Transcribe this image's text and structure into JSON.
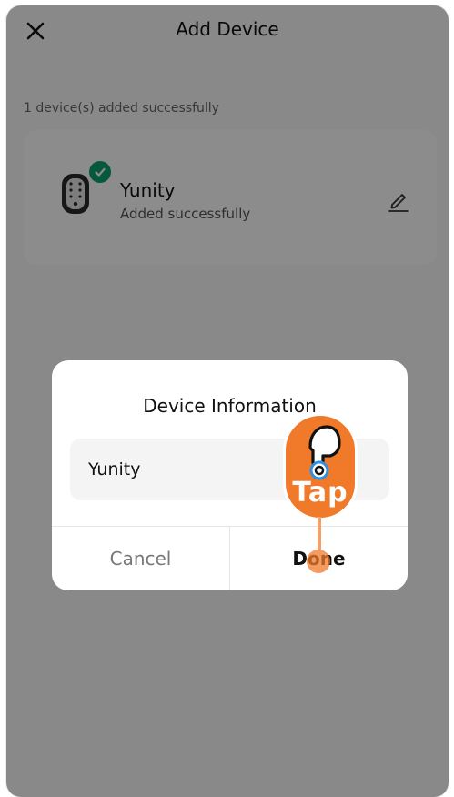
{
  "header": {
    "title": "Add Device"
  },
  "status": {
    "success_count_text": "1 device(s) added successfully"
  },
  "device": {
    "name": "Yunity",
    "subtitle": "Added successfully"
  },
  "modal": {
    "title": "Device Information",
    "input_value": "Yunity",
    "cancel_label": "Cancel",
    "done_label": "Done"
  },
  "tap_hint": {
    "label": "Tap"
  },
  "colors": {
    "accent_green": "#0aa06e",
    "tap_orange": "#f07a2a",
    "overlay": "rgba(0,0,0,0.45)"
  },
  "icons": {
    "close": "close-icon",
    "edit": "edit-icon",
    "check": "check-icon",
    "device": "smart-lock-icon",
    "hand": "pointing-hand-icon"
  }
}
